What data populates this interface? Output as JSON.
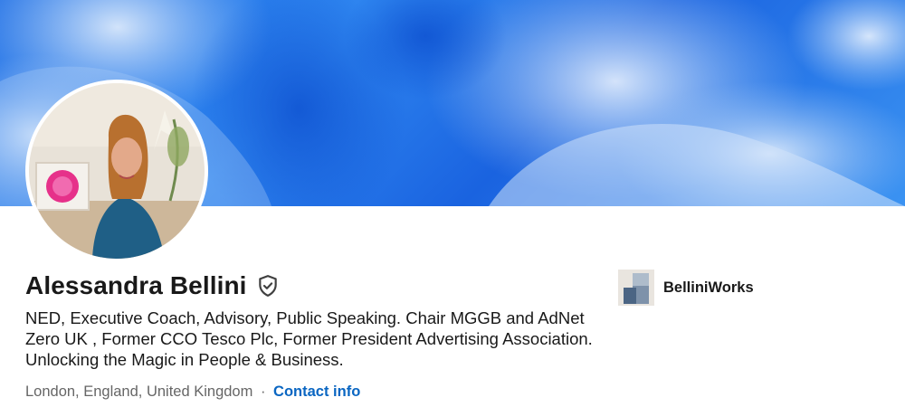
{
  "profile": {
    "name": "Alessandra Bellini",
    "headline": "NED, Executive Coach, Advisory, Public Speaking. Chair MGGB and AdNet Zero UK , Former CCO Tesco Plc, Former President Advertising Association. Unlocking the Magic in People & Business.",
    "location": "London, England, United Kingdom",
    "separator": "·",
    "contact_label": "Contact info"
  },
  "company": {
    "name": "BelliniWorks"
  },
  "icons": {
    "verified": "shield-check-icon",
    "company_logo": "company-logo-icon"
  },
  "colors": {
    "link": "#0a66c2",
    "text": "#191919",
    "muted": "#666666",
    "banner": "#1f6fe5"
  }
}
